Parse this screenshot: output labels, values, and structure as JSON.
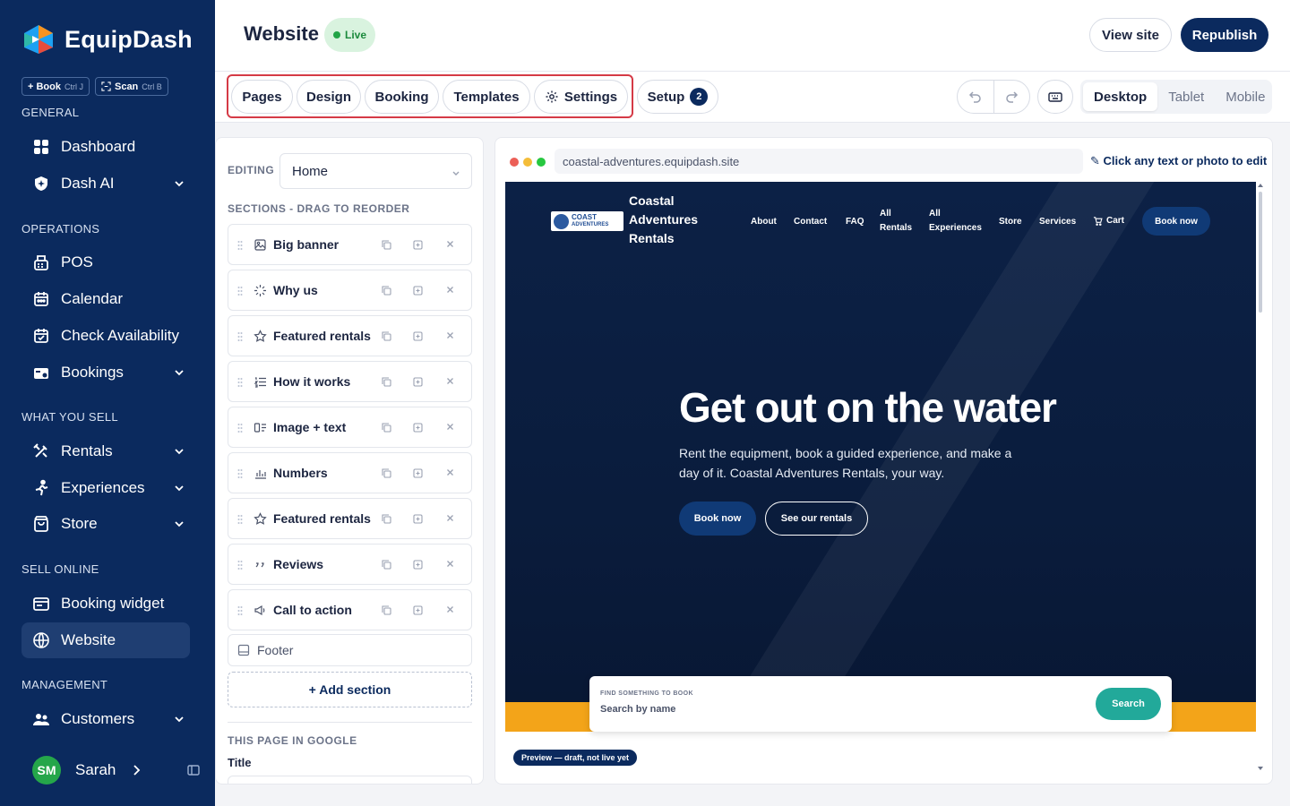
{
  "brand": {
    "name": "EquipDash"
  },
  "quick_actions": [
    {
      "label": "+ Book",
      "shortcut": "Ctrl J"
    },
    {
      "label": "Scan",
      "shortcut": "Ctrl B"
    }
  ],
  "sidebar": {
    "sections": [
      "GENERAL",
      "OPERATIONS",
      "WHAT YOU SELL",
      "SELL ONLINE",
      "MANAGEMENT"
    ],
    "items": [
      {
        "label": "Dashboard",
        "icon": "grid-icon"
      },
      {
        "label": "Dash AI",
        "icon": "ai-shield-icon",
        "expandable": true
      },
      {
        "label": "POS",
        "icon": "register-icon"
      },
      {
        "label": "Calendar",
        "icon": "calendar-icon"
      },
      {
        "label": "Check Availability",
        "icon": "calendar-check-icon"
      },
      {
        "label": "Bookings",
        "icon": "bookings-icon",
        "expandable": true
      },
      {
        "label": "Rentals",
        "icon": "tools-icon",
        "expandable": true
      },
      {
        "label": "Experiences",
        "icon": "person-activity-icon",
        "expandable": true
      },
      {
        "label": "Store",
        "icon": "bag-icon",
        "expandable": true
      },
      {
        "label": "Booking widget",
        "icon": "widget-icon"
      },
      {
        "label": "Website",
        "icon": "globe-icon",
        "active": true
      },
      {
        "label": "Customers",
        "icon": "users-icon",
        "expandable": true
      }
    ],
    "user": {
      "initials": "SM",
      "name": "Sarah"
    }
  },
  "header": {
    "title": "Website",
    "status": "Live",
    "view_site": "View site",
    "republish": "Republish"
  },
  "tabs": {
    "items": [
      "Pages",
      "Design",
      "Booking",
      "Templates",
      "Settings"
    ],
    "setup": {
      "label": "Setup",
      "count": "2"
    },
    "devices": [
      "Desktop",
      "Tablet",
      "Mobile"
    ],
    "active_device": "Desktop"
  },
  "editor": {
    "editing_label": "EDITING",
    "page": "Home",
    "sections_label": "SECTIONS - DRAG TO REORDER",
    "sections": [
      {
        "name": "Big banner",
        "icon": "image-icon"
      },
      {
        "name": "Why us",
        "icon": "sparkle-icon"
      },
      {
        "name": "Featured rentals",
        "icon": "star-icon"
      },
      {
        "name": "How it works",
        "icon": "numbered-list-icon"
      },
      {
        "name": "Image + text",
        "icon": "image-text-icon"
      },
      {
        "name": "Numbers",
        "icon": "bar-chart-icon"
      },
      {
        "name": "Featured rentals",
        "icon": "star-icon"
      },
      {
        "name": "Reviews",
        "icon": "quote-icon"
      },
      {
        "name": "Call to action",
        "icon": "megaphone-icon"
      }
    ],
    "footer": "Footer",
    "add_section": "+ Add section",
    "google_label": "THIS PAGE IN GOOGLE",
    "title_label": "Title"
  },
  "preview": {
    "url": "coastal-adventures.equipdash.site",
    "hint": "✎ Click any text or photo to edit",
    "site": {
      "logo_text": [
        "COAST",
        "ADVENTURES"
      ],
      "name": "Coastal Adventures Rentals",
      "nav": [
        "About",
        "Contact",
        "FAQ",
        "All Rentals",
        "All Experiences",
        "Store",
        "Services",
        "Cart"
      ],
      "book_now": "Book now",
      "hero_title": "Get out on the water",
      "hero_sub": "Rent the equipment, book a guided experience, and make a day of it. Coastal Adventures Rentals, your way.",
      "hero_btn_primary": "Book now",
      "hero_btn_secondary": "See our rentals",
      "search_label": "FIND SOMETHING TO BOOK",
      "search_placeholder": "Search by name",
      "search_button": "Search"
    },
    "draft_badge": "Preview — draft, not live yet"
  },
  "colors": {
    "sidebar": "#0b2a5e",
    "accent": "#0b2a5e",
    "live": "#22a447",
    "highlight_border": "#d53a46",
    "orange": "#f3a419",
    "teal": "#22a99a"
  }
}
